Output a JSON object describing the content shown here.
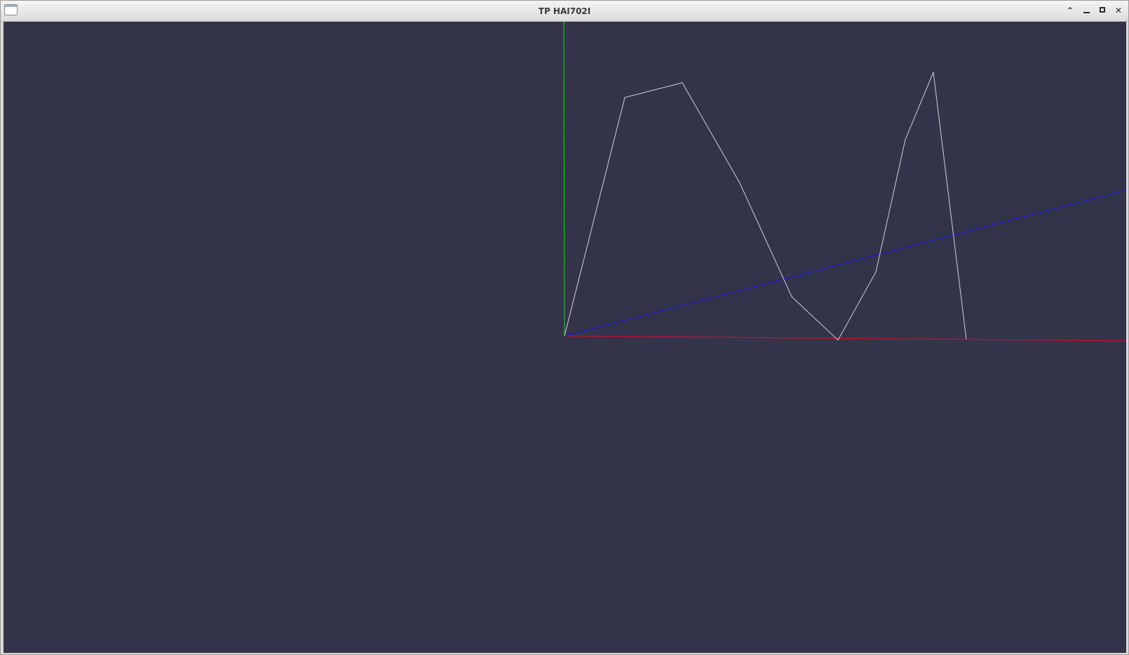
{
  "window": {
    "title": "TP HAI702I"
  },
  "icons": {
    "app": "app-window-icon",
    "shade": "chevron-up-icon",
    "minimize": "minimize-icon",
    "maximize": "maximize-icon",
    "close": "close-icon"
  },
  "scene": {
    "background": "#33344a",
    "axes": {
      "x_color": "#c8102e",
      "y_color": "#22cc22",
      "z_color": "#1a1ad0"
    },
    "curve_color": "#cfcfd8"
  }
}
